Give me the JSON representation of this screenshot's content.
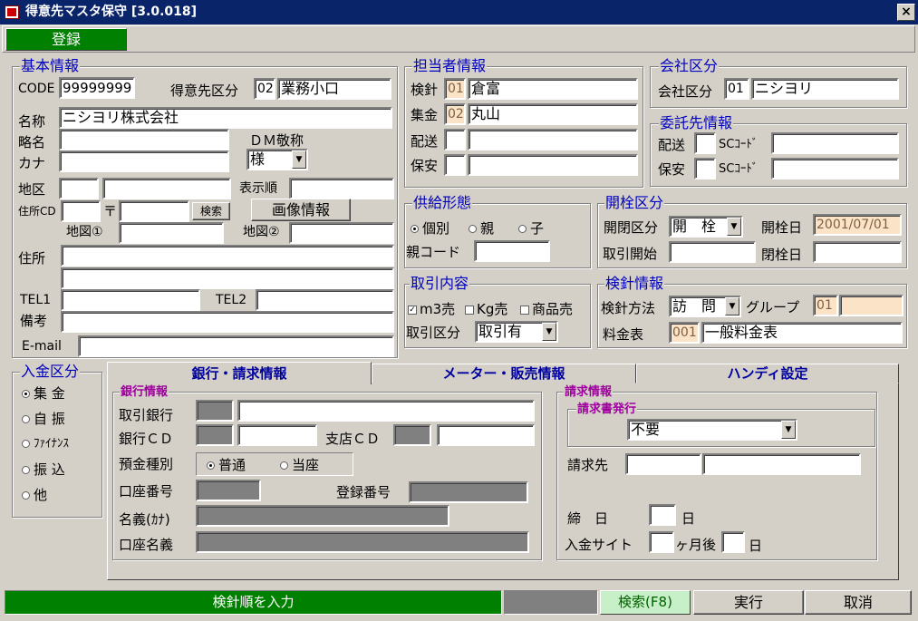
{
  "window": {
    "title": "得意先マスタ保守 [3.0.018]",
    "close_glyph": "×"
  },
  "toolbar": {
    "register_label": "登録"
  },
  "basic": {
    "title": "基本情報",
    "code_label": "CODE",
    "code_value": "99999999",
    "kubun_label": "得意先区分",
    "kubun_code": "02",
    "kubun_name": "業務小口",
    "name_label": "名称",
    "name_value": "ニシヨリ株式会社",
    "short_label": "略名",
    "dm_label": "ＤＭ敬称",
    "dm_value": "様",
    "kana_label": "カナ",
    "area_label": "地区",
    "order_label": "表示順",
    "addrcd_label": "住所CD",
    "zip_glyph": "〒",
    "search_btn": "検索",
    "image_btn": "画像情報",
    "map1_label": "地図①",
    "map2_label": "地図②",
    "addr_label": "住所",
    "tel1_label": "TEL1",
    "tel2_label": "TEL2",
    "note_label": "備考",
    "email_label": "E-mail"
  },
  "staff": {
    "title": "担当者情報",
    "rows": [
      {
        "label": "検針",
        "code": "01",
        "name": "倉富"
      },
      {
        "label": "集金",
        "code": "02",
        "name": "丸山"
      },
      {
        "label": "配送",
        "code": "",
        "name": ""
      },
      {
        "label": "保安",
        "code": "",
        "name": ""
      }
    ]
  },
  "company": {
    "title": "会社区分",
    "label": "会社区分",
    "code": "01",
    "name": "ニシヨリ"
  },
  "consign": {
    "title": "委託先情報",
    "rows": [
      {
        "label": "配送",
        "sc_label": "SCｺｰﾄﾞ"
      },
      {
        "label": "保安",
        "sc_label": "SCｺｰﾄﾞ"
      }
    ]
  },
  "supply": {
    "title": "供給形態",
    "options": [
      "個別",
      "親",
      "子"
    ],
    "selected": 0,
    "parent_label": "親コード"
  },
  "valve": {
    "title": "開栓区分",
    "kubun_label": "開閉区分",
    "kubun_value": "開　栓",
    "open_label": "開栓日",
    "open_date": "2001/07/01",
    "start_label": "取引開始",
    "close_label": "閉栓日"
  },
  "trade": {
    "title": "取引内容",
    "checks": [
      {
        "label": "m3売",
        "checked": true
      },
      {
        "label": "Kg売",
        "checked": false
      },
      {
        "label": "商品売",
        "checked": false
      }
    ],
    "kubun_label": "取引区分",
    "kubun_value": "取引有"
  },
  "meter": {
    "title": "検針情報",
    "method_label": "検針方法",
    "method_value": "訪　問",
    "group_label": "グループ",
    "group_code": "01",
    "rate_label": "料金表",
    "rate_code": "001",
    "rate_name": "一般料金表"
  },
  "payment": {
    "title": "入金区分",
    "options": [
      "集 金",
      "自 振",
      "ﾌｧｲﾅﾝｽ",
      "振 込",
      "他"
    ],
    "selected": 0
  },
  "tabs": [
    "銀行・請求情報",
    "メーター・販売情報",
    "ハンディ設定"
  ],
  "bank": {
    "title": "銀行情報",
    "bank_label": "取引銀行",
    "bankcd_label": "銀行ＣＤ",
    "branch_label": "支店ＣＤ",
    "deposit_label": "預金種別",
    "deposit_options": [
      "普通",
      "当座"
    ],
    "deposit_selected": 0,
    "account_label": "口座番号",
    "reg_label": "登録番号",
    "holder_kana_label": "名義(ｶﾅ)",
    "holder_label": "口座名義"
  },
  "billing": {
    "title": "請求情報",
    "issue_title": "請求書発行",
    "issue_value": "不要",
    "dest_label": "請求先",
    "close_label": "締　日",
    "day_unit": "日",
    "site_label": "入金サイト",
    "month_unit": "ヶ月後"
  },
  "status": {
    "message": "検針順を入力",
    "search_btn": "検索(F8)",
    "exec_btn": "実行",
    "cancel_btn": "取消"
  }
}
